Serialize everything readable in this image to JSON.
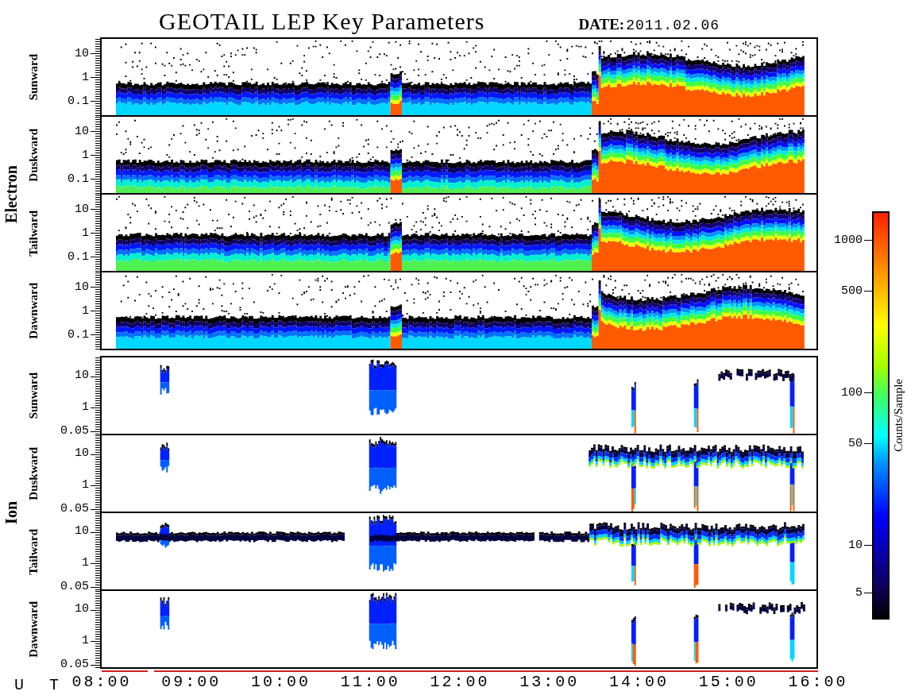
{
  "title": "GEOTAIL LEP Key Parameters",
  "date_label": "DATE:",
  "date_value": "2011.02.06",
  "groups": [
    {
      "species": "Electron",
      "kind": "electron",
      "panels": [
        {
          "direction": "Sunward",
          "ticks": [
            "10",
            "1",
            "0.1"
          ]
        },
        {
          "direction": "Duskward",
          "ticks": [
            "10",
            "1",
            "0.1"
          ]
        },
        {
          "direction": "Tailward",
          "ticks": [
            "10",
            "1",
            "0.1"
          ]
        },
        {
          "direction": "Dawnward",
          "ticks": [
            "10",
            "1",
            "0.1"
          ]
        }
      ]
    },
    {
      "species": "Ion",
      "kind": "ion",
      "panels": [
        {
          "direction": "Sunward",
          "ticks": [
            "10",
            "1",
            "0.05"
          ]
        },
        {
          "direction": "Duskward",
          "ticks": [
            "10",
            "1",
            "0.05"
          ]
        },
        {
          "direction": "Tailward",
          "ticks": [
            "10",
            "1",
            "0.05"
          ]
        },
        {
          "direction": "Dawnward",
          "ticks": [
            "10",
            "1",
            "0.05"
          ]
        }
      ]
    }
  ],
  "time_axis": {
    "label": "U T",
    "ticks": [
      "08:00",
      "09:00",
      "10:00",
      "11:00",
      "12:00",
      "13:00",
      "14:00",
      "15:00",
      "16:00"
    ]
  },
  "colorbar": {
    "label": "Counts/Sample",
    "ticks": [
      "1000",
      "500",
      "100",
      "50",
      "10",
      "5"
    ]
  }
}
